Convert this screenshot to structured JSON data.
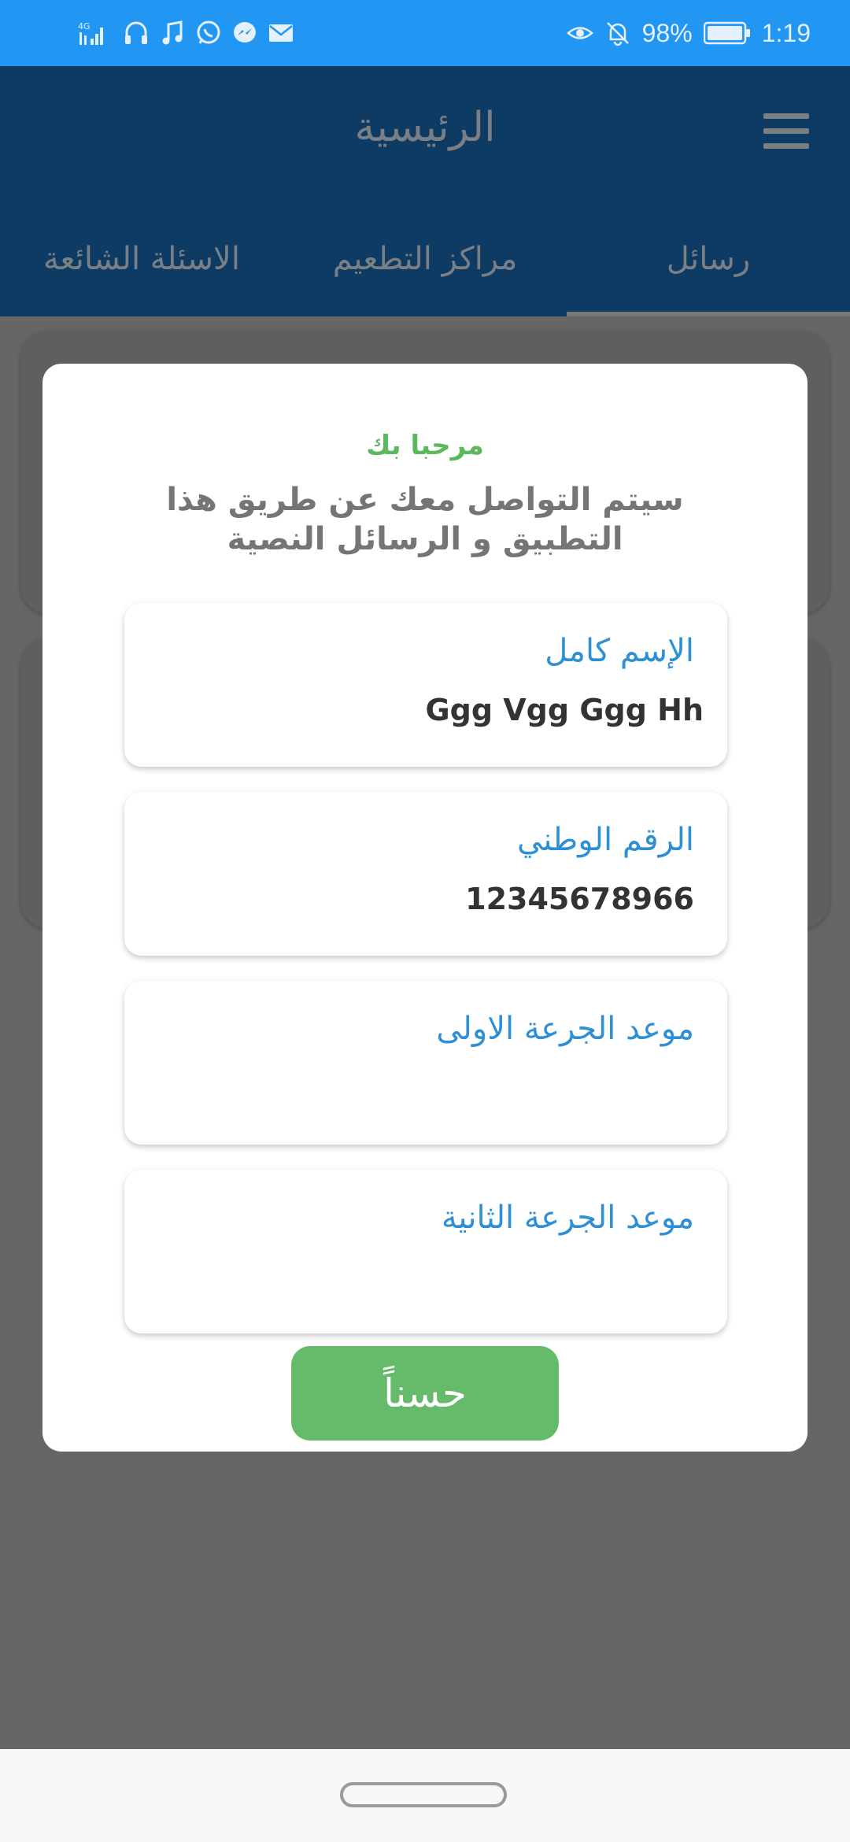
{
  "status_bar": {
    "network": "4G",
    "battery": "98%",
    "time": "1:19",
    "left_icons": [
      "signal-icon",
      "headphones-icon",
      "music-icon",
      "whatsapp-icon",
      "messenger-icon",
      "mail-icon"
    ],
    "right_icons": [
      "eye-icon",
      "bell-off-icon",
      "battery-icon"
    ]
  },
  "header": {
    "title": "الرئيسية",
    "menu_icon": "hamburger-menu-icon"
  },
  "tabs": [
    {
      "label": "رسائل",
      "active": true
    },
    {
      "label": "مراكز التطعيم",
      "active": false
    },
    {
      "label": "الاسئلة الشائعة",
      "active": false
    }
  ],
  "dialog": {
    "welcome": "مرحبا بك",
    "subtitle": "سيتم التواصل معك عن طريق هذا التطبيق و الرسائل النصية",
    "fields": [
      {
        "label": "الإسم كامل",
        "value": "Ggg Vgg Ggg Hh"
      },
      {
        "label": "الرقم الوطني",
        "value": "12345678966"
      },
      {
        "label": "موعد الجرعة الاولى",
        "value": ""
      },
      {
        "label": "موعد الجرعة الثانية",
        "value": ""
      }
    ],
    "ok_label": "حسناً"
  },
  "colors": {
    "status_bar": "#2196F3",
    "header": "#0d3b63",
    "welcome": "#5cb85c",
    "field_label": "#2f8fd3",
    "button": "#66bb6a",
    "overlay": "#666666"
  }
}
